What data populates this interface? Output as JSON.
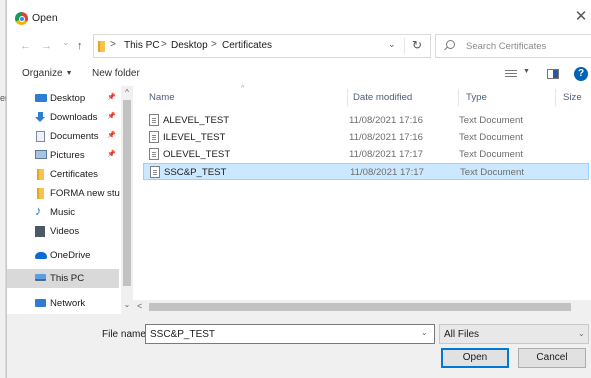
{
  "background_edge_text": "er",
  "title": {
    "text": "Open",
    "close_glyph": "✕"
  },
  "nav": {
    "back_glyph": "←",
    "forward_glyph": "→",
    "dropdown_glyph": "⌄",
    "up_glyph": "↑",
    "breadcrumb": [
      "This PC",
      "Desktop",
      "Certificates"
    ],
    "separator": ">",
    "refresh_glyph": "↻",
    "search_placeholder": "Search Certificates"
  },
  "commands": {
    "organize": "Organize",
    "new_folder": "New folder",
    "help_glyph": "?"
  },
  "sidebar": {
    "items": [
      {
        "label": "Desktop",
        "icon": "desktop-icon",
        "pinned": true
      },
      {
        "label": "Downloads",
        "icon": "download-icon",
        "pinned": true
      },
      {
        "label": "Documents",
        "icon": "documents-icon",
        "pinned": true
      },
      {
        "label": "Pictures",
        "icon": "pictures-icon",
        "pinned": true
      },
      {
        "label": "Certificates",
        "icon": "folder-icon",
        "pinned": false
      },
      {
        "label": "FORMA new stud",
        "icon": "folder-icon",
        "pinned": false
      },
      {
        "label": "Music",
        "icon": "music-icon",
        "pinned": false
      },
      {
        "label": "Videos",
        "icon": "videos-icon",
        "pinned": false
      },
      {
        "label": "OneDrive",
        "icon": "onedrive-icon",
        "pinned": false
      },
      {
        "label": "This PC",
        "icon": "this-pc-icon",
        "pinned": false,
        "selected": true
      },
      {
        "label": "Network",
        "icon": "network-icon",
        "pinned": false
      }
    ],
    "pin_glyph": "📌",
    "expand_glyph": "⌄"
  },
  "files": {
    "columns": [
      "Name",
      "Date modified",
      "Type",
      "Size"
    ],
    "rows": [
      {
        "name": "ALEVEL_TEST",
        "date": "11/08/2021 17:16",
        "type": "Text Document"
      },
      {
        "name": "ILEVEL_TEST",
        "date": "11/08/2021 17:16",
        "type": "Text Document"
      },
      {
        "name": "OLEVEL_TEST",
        "date": "11/08/2021 17:17",
        "type": "Text Document"
      },
      {
        "name": "SSC&P_TEST",
        "date": "11/08/2021 17:17",
        "type": "Text Document",
        "selected": true
      }
    ]
  },
  "footer": {
    "file_name_label": "File name:",
    "file_name_value": "SSC&P_TEST",
    "file_type": "All Files",
    "open_label": "Open",
    "cancel_label": "Cancel"
  },
  "colors": {
    "selection": "#cce8ff",
    "selection_border": "#99d1ff",
    "accent": "#0078d7",
    "folder": "#f6c44a"
  }
}
